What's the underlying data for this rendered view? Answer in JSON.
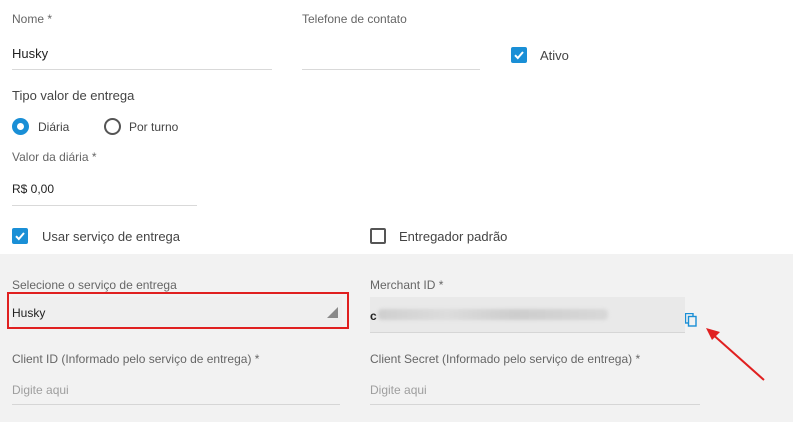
{
  "form": {
    "nome": {
      "label": "Nome *",
      "value": "Husky"
    },
    "telefone": {
      "label": "Telefone de contato",
      "value": ""
    },
    "ativo": {
      "label": "Ativo",
      "checked": true
    },
    "tipo_valor": {
      "label": "Tipo valor de entrega",
      "options": [
        {
          "label": "Diária",
          "selected": true
        },
        {
          "label": "Por turno",
          "selected": false
        }
      ]
    },
    "valor_diaria": {
      "label": "Valor da diária *",
      "value": "R$ 0,00"
    },
    "usar_servico": {
      "label": "Usar serviço de entrega",
      "checked": true
    },
    "entregador_padrao": {
      "label": "Entregador padrão",
      "checked": false
    }
  },
  "delivery": {
    "servico": {
      "label": "Selecione o serviço de entrega",
      "value": "Husky"
    },
    "merchant": {
      "label": "Merchant ID *",
      "value_prefix": "c"
    },
    "client_id": {
      "label": "Client ID (Informado pelo serviço de entrega) *",
      "placeholder": "Digite aqui"
    },
    "client_secret": {
      "label": "Client Secret (Informado pelo serviço de entrega) *",
      "placeholder": "Digite aqui"
    }
  },
  "colors": {
    "accent": "#1a8fd6",
    "highlight_border": "#e02020",
    "arrow": "#e02020",
    "panel_bg": "#f2f2f2"
  }
}
